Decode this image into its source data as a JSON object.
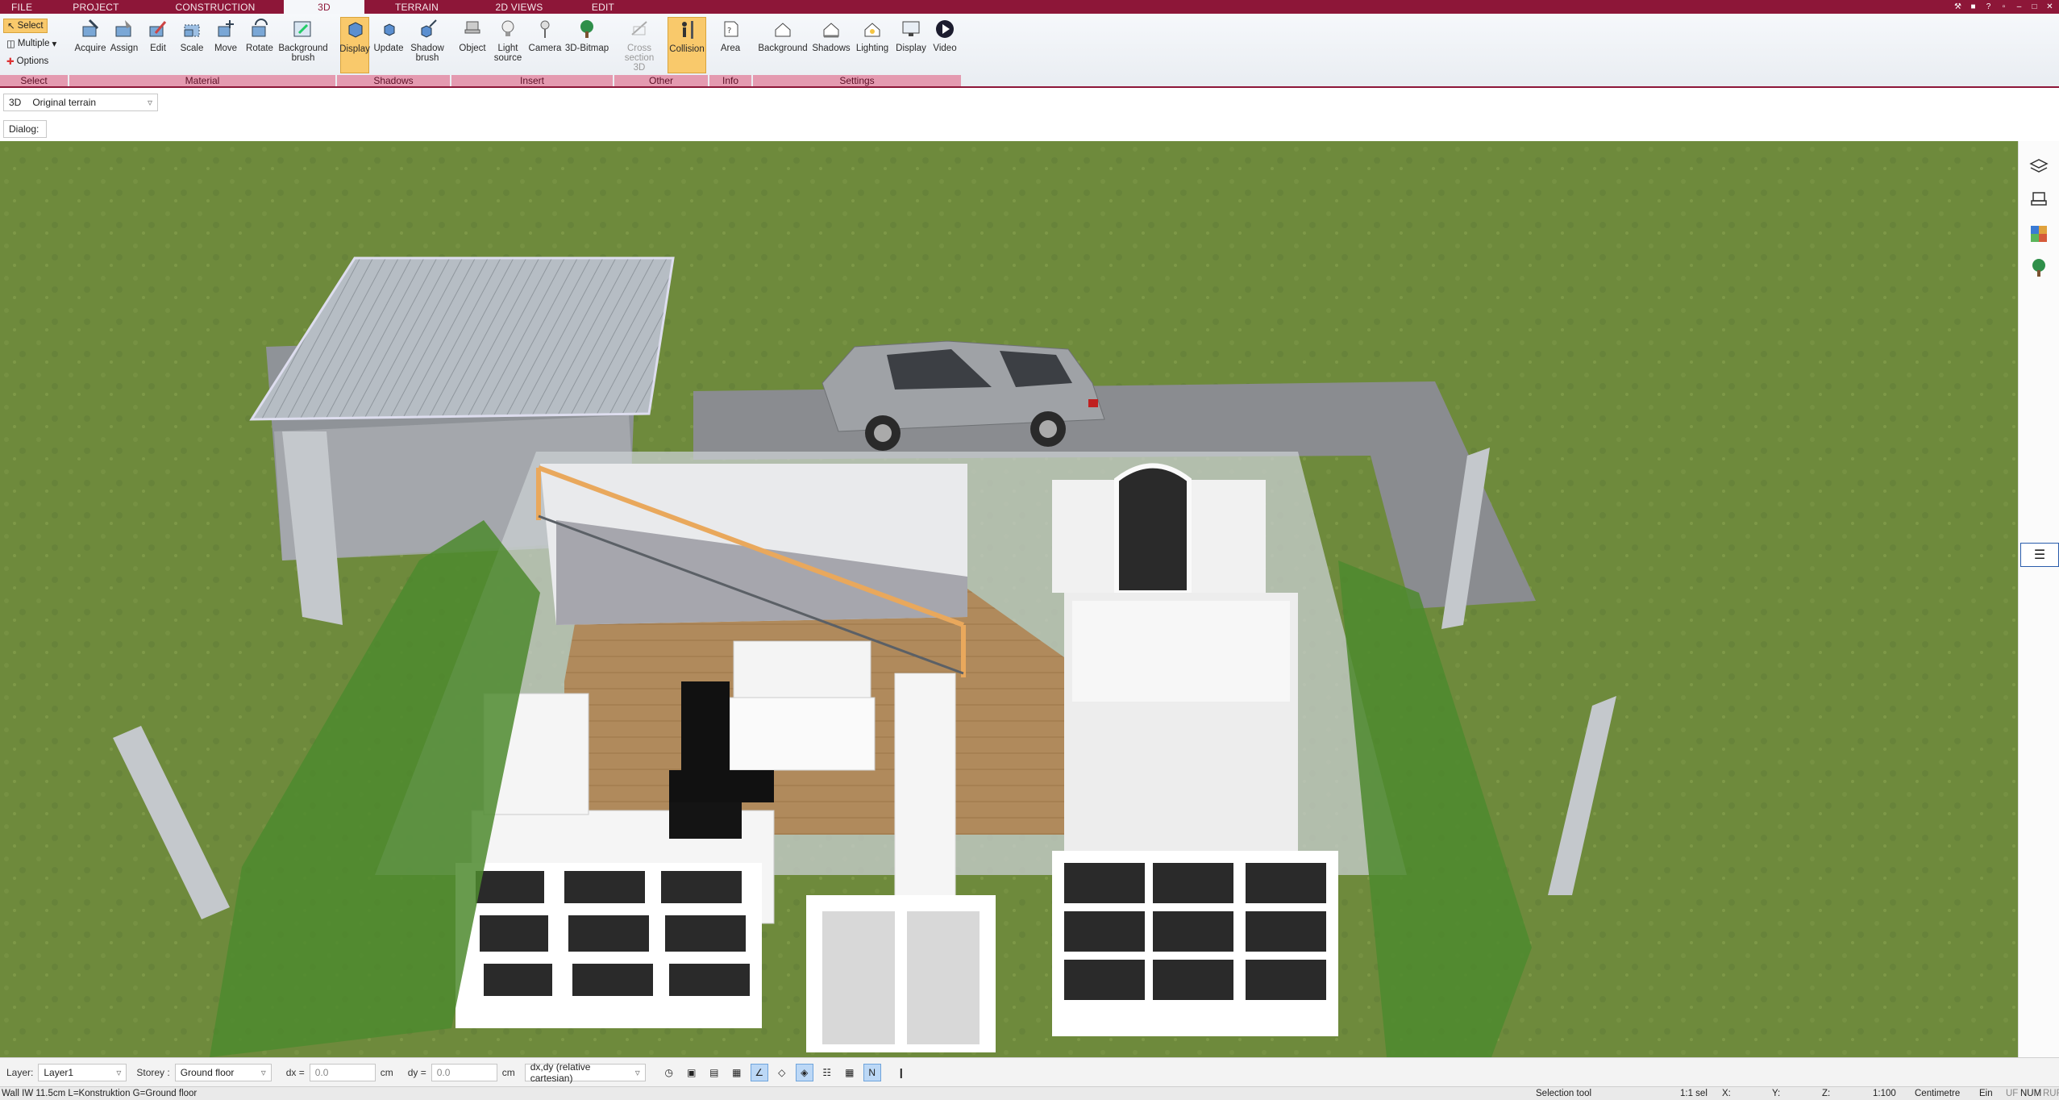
{
  "menu": {
    "tabs": [
      {
        "label": "FILE"
      },
      {
        "label": "PROJECT"
      },
      {
        "label": "CONSTRUCTION"
      },
      {
        "label": "3D"
      },
      {
        "label": "TERRAIN"
      },
      {
        "label": "2D VIEWS"
      },
      {
        "label": "EDIT"
      }
    ],
    "active_tab": "3D"
  },
  "ribbon": {
    "select_group": {
      "select": "Select",
      "multiple": "Multiple",
      "options": "Options",
      "label": "Select"
    },
    "material": {
      "label": "Material",
      "buttons": [
        "Acquire",
        "Assign",
        "Edit",
        "Scale",
        "Move",
        "Rotate",
        "Background\nbrush"
      ]
    },
    "shadows": {
      "label": "Shadows",
      "buttons": [
        "Display",
        "Update",
        "Shadow\nbrush"
      ]
    },
    "insert": {
      "label": "Insert",
      "buttons": [
        "Object",
        "Light\nsource",
        "Camera",
        "3D-Bitmap"
      ]
    },
    "other": {
      "label": "Other",
      "buttons": [
        "Cross\nsection 3D",
        "Collision"
      ]
    },
    "info": {
      "label": "Info",
      "buttons": [
        "Area"
      ]
    },
    "settings": {
      "label": "Settings",
      "buttons": [
        "Background",
        "Shadows",
        "Lighting",
        "Display",
        "Video"
      ]
    }
  },
  "options_bar": {
    "mode": "3D",
    "terrain": "Original terrain"
  },
  "dialog_bar": {
    "label": "Dialog:"
  },
  "status": {
    "layer_label": "Layer:",
    "layer_value": "Layer1",
    "storey_label": "Storey :",
    "storey_value": "Ground floor",
    "dx_label": "dx =",
    "dx_value": "0.0",
    "dx_unit": "cm",
    "dy_label": "dy =",
    "dy_value": "0.0",
    "dy_unit": "cm",
    "coord_mode": "dx,dy (relative cartesian)"
  },
  "bottom": {
    "hint": "Wall IW 11.5cm L=Konstruktion G=Ground floor",
    "tool": "Selection tool",
    "sel": "1:1 sel",
    "x": "X:",
    "y": "Y:",
    "z": "Z:",
    "scale": "1:100",
    "unit": "Centimetre",
    "ein": "Ein",
    "uf": "UF",
    "num": "NUM",
    "ruf": "RUF"
  },
  "colors": {
    "brand": "#8d1638",
    "group_label": "#e49ab0",
    "active": "#f9c96b",
    "grass": "#6f8a3c"
  }
}
